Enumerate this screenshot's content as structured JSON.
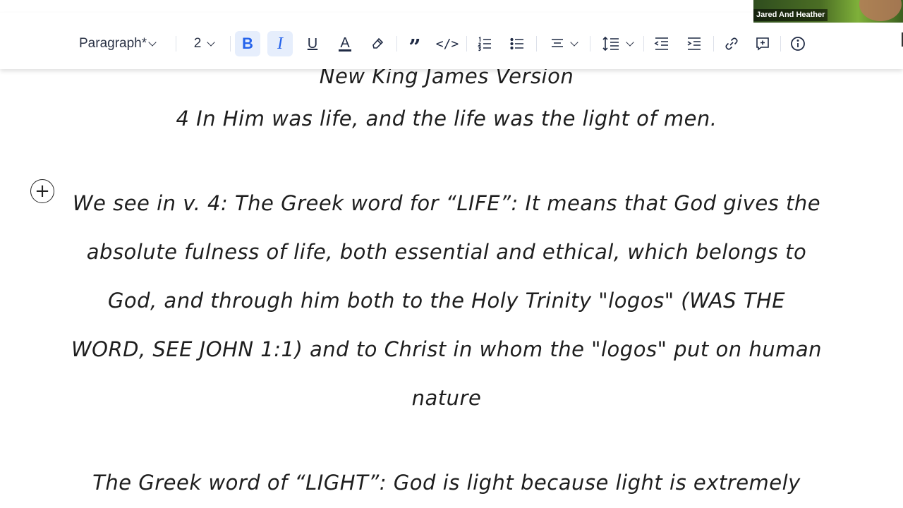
{
  "webcam": {
    "name": "Jared And Heather"
  },
  "toolbar": {
    "paragraph_style": "Paragraph*",
    "font_size": "2",
    "bold_label": "B",
    "italic_label": "I",
    "underline_label": "U",
    "text_color_label": "A",
    "icons": [
      "bold-icon",
      "italic-icon",
      "underline-icon",
      "text-color-icon",
      "highlight-icon",
      "blockquote-icon",
      "code-icon",
      "numbered-list-icon",
      "bulleted-list-icon",
      "align-icon",
      "line-height-icon",
      "outdent-icon",
      "indent-icon",
      "link-icon",
      "add-embed-icon",
      "info-icon"
    ],
    "accent_color": "#2563eb",
    "active_bg": "#e6eefc"
  },
  "document": {
    "version_line": "New King James Version",
    "verse_line": "4 In Him was life, and the life was the light of men.",
    "paragraph_1": "We see in v. 4: The Greek word for “LIFE”: It means that God gives the absolute fulness of life, both essential and ethical, which belongs to God, and through him both to the Holy Trinity \"logos\" (WAS THE WORD, SEE JOHN 1:1) and to Christ in whom the \"logos\" put on human nature",
    "paragraph_2": "The Greek word of “LIGHT”: God is light because light is extremely"
  },
  "add_block_symbol": "+"
}
